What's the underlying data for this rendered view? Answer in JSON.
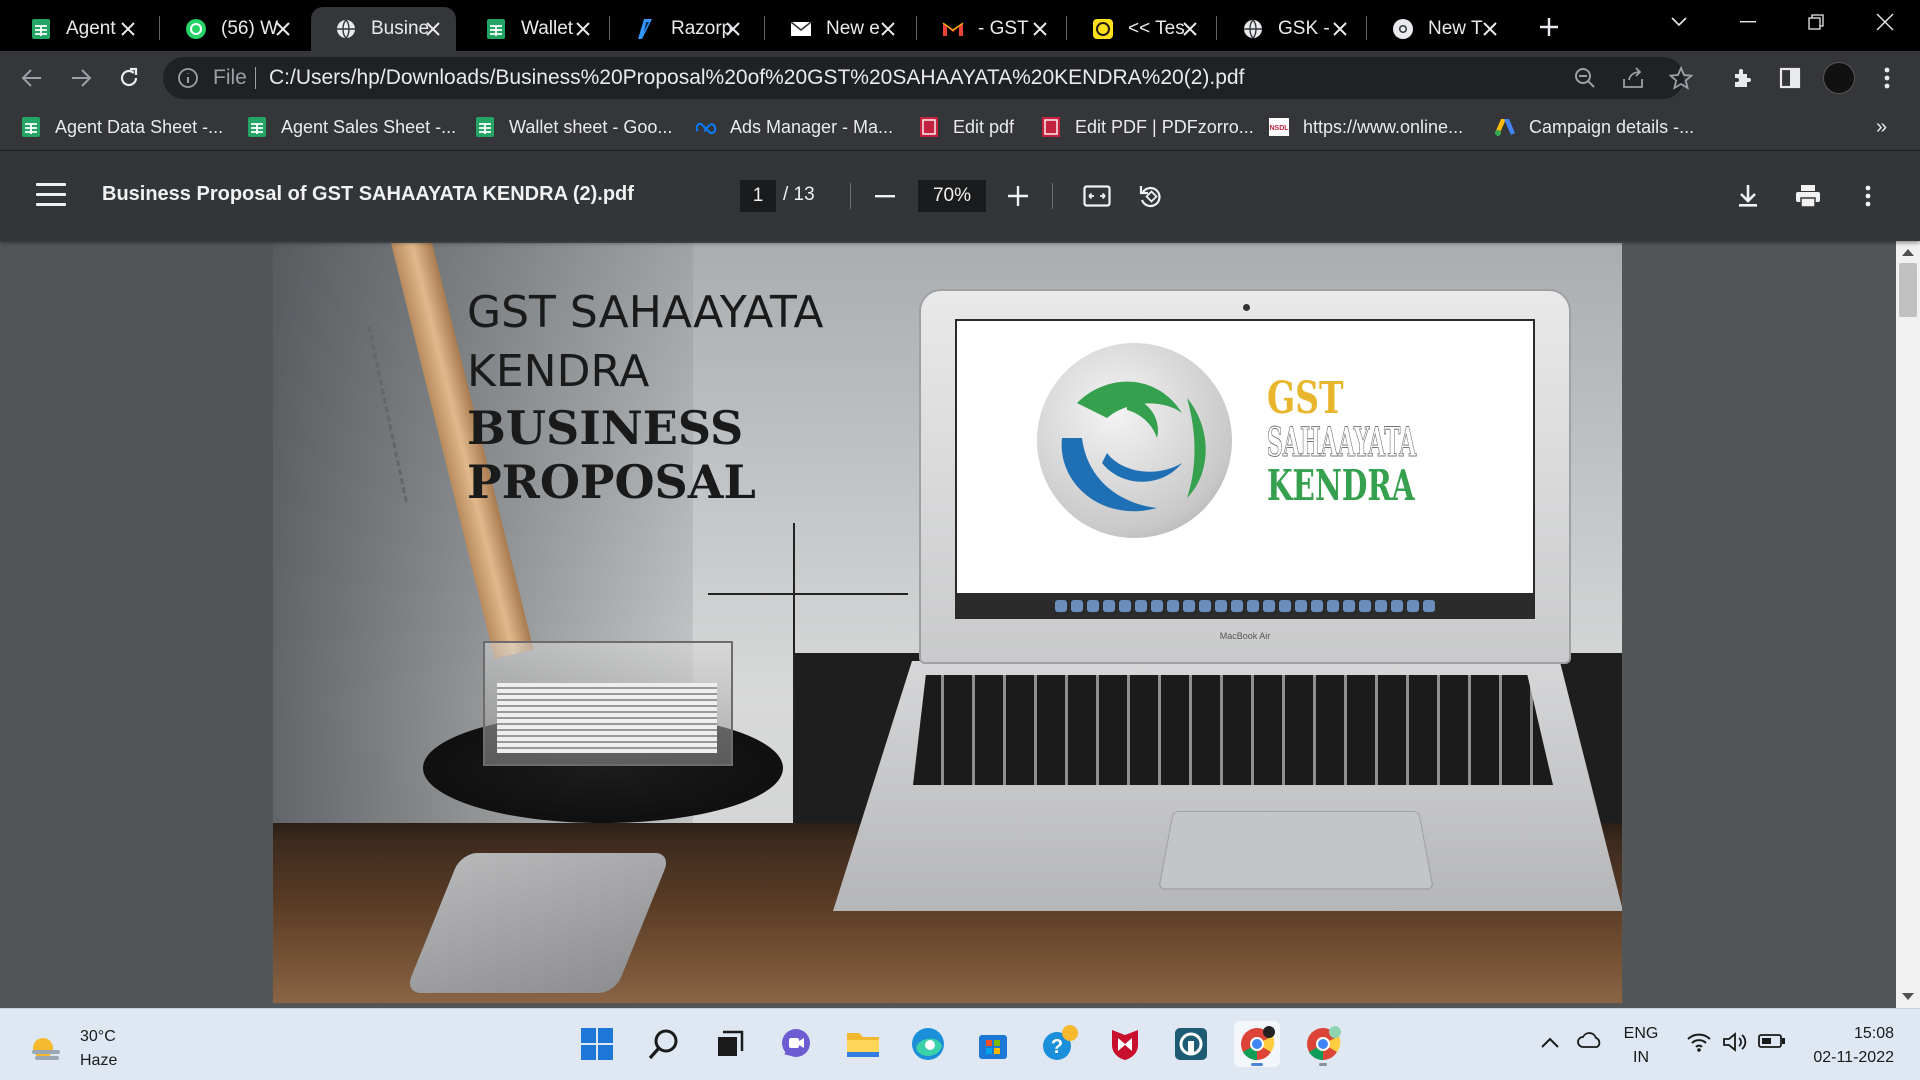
{
  "browser": {
    "tabs": [
      {
        "title": "Agent",
        "icon": "google-sheets-icon",
        "active": false
      },
      {
        "title": "(56) W",
        "icon": "whatsapp-icon",
        "active": false
      },
      {
        "title": "Busine",
        "icon": "globe-icon",
        "active": true
      },
      {
        "title": "Wallet",
        "icon": "google-sheets-icon",
        "active": false
      },
      {
        "title": "Razorp",
        "icon": "razorpay-icon",
        "active": false
      },
      {
        "title": "New e",
        "icon": "mail-icon",
        "active": false
      },
      {
        "title": "- GST",
        "icon": "gmail-icon",
        "active": false
      },
      {
        "title": "<< Tes",
        "icon": "mailchimp-icon",
        "active": false
      },
      {
        "title": "GSK -",
        "icon": "globe-icon",
        "active": false
      },
      {
        "title": "New T",
        "icon": "chrome-icon",
        "active": false
      }
    ],
    "address": {
      "scheme_label": "File",
      "url": "C:/Users/hp/Downloads/Business%20Proposal%20of%20GST%20SAHAAYATA%20KENDRA%20(2).pdf"
    },
    "bookmarks": [
      {
        "label": "Agent Data Sheet -...",
        "icon": "google-sheets-icon"
      },
      {
        "label": "Agent Sales Sheet -...",
        "icon": "google-sheets-icon"
      },
      {
        "label": "Wallet sheet - Goo...",
        "icon": "google-sheets-icon"
      },
      {
        "label": "Ads Manager - Ma...",
        "icon": "meta-icon"
      },
      {
        "label": "Edit pdf",
        "icon": "pdf-icon"
      },
      {
        "label": "Edit PDF | PDFzorro...",
        "icon": "pdf-icon"
      },
      {
        "label": "https://www.online...",
        "icon": "nsdl-icon"
      },
      {
        "label": "Campaign details -...",
        "icon": "google-ads-icon"
      }
    ],
    "bookmarks_more": "»"
  },
  "pdf": {
    "file_title": "Business Proposal of GST SAHAAYATA KENDRA (2).pdf",
    "current_page": "1",
    "page_total": "/ 13",
    "zoom": "70%",
    "cover": {
      "line1": "GST SAHAAYATA",
      "line2": "KENDRA",
      "line3": "BUSINESS",
      "line4": "PROPOSAL"
    },
    "screen_logo": {
      "line1": "GST",
      "line2": "SAHAAYATA",
      "line3": "KENDRA",
      "brand_colors": {
        "gold": "#e8b52d",
        "green": "#35a04d",
        "blue": "#1f6fb5"
      }
    },
    "laptop_label": "MacBook Air"
  },
  "taskbar": {
    "weather": {
      "temp": "30°C",
      "condition": "Haze"
    },
    "language": {
      "line1": "ENG",
      "line2": "IN"
    },
    "clock": {
      "time": "15:08",
      "date": "02-11-2022"
    }
  },
  "colors": {
    "tab_strip": "#000000",
    "toolbar": "#35363a",
    "pdf_toolbar": "#323639",
    "pdf_canvas": "#525659",
    "taskbar": "#dfe8f2"
  }
}
